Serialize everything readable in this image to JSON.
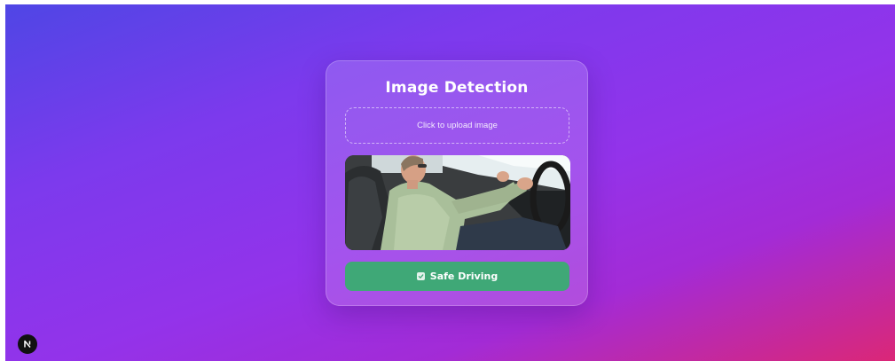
{
  "card": {
    "title": "Image Detection",
    "upload_label": "Click to upload image",
    "result_label": "Safe Driving",
    "result_icon": "checkbox-checked-icon"
  },
  "dev_badge": {
    "icon": "nextjs-logo-icon"
  },
  "colors": {
    "background_start": "#4f46e5",
    "background_mid": "#9333ea",
    "background_end": "#db2777",
    "result_green": "#3fa877",
    "badge": "#111111"
  }
}
